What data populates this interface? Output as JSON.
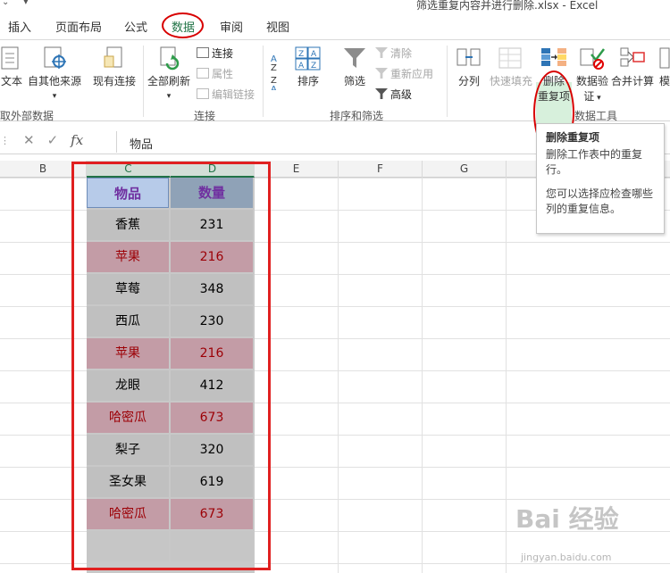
{
  "window": {
    "title": "筛选重复内容并进行删除.xlsx - Excel"
  },
  "tabs": [
    "插入",
    "页面布局",
    "公式",
    "数据",
    "审阅",
    "视图"
  ],
  "active_tab": "数据",
  "ribbon": {
    "get_external": {
      "from_text": "文本",
      "from_other": "自其他来源",
      "existing": "现有连接",
      "label": "取外部数据"
    },
    "connections": {
      "refresh_all": "全部刷新",
      "connections": "连接",
      "properties": "属性",
      "edit_links": "编辑链接",
      "label": "连接"
    },
    "sort_filter": {
      "sort": "排序",
      "filter": "筛选",
      "clear": "清除",
      "reapply": "重新应用",
      "advanced": "高级",
      "label": "排序和筛选"
    },
    "data_tools": {
      "text_to_columns": "分列",
      "flash_fill": "快速填充",
      "remove_duplicates_line1": "删除",
      "remove_duplicates_line2": "重复项",
      "validation_line1": "数据验",
      "validation_line2": "证",
      "consolidate": "合并计算",
      "model": "模",
      "label": "数据工具"
    }
  },
  "tooltip": {
    "title": "删除重复项",
    "desc": "删除工作表中的重复行。",
    "detail": "您可以选择应检查哪些列的重复信息。"
  },
  "formula_bar": {
    "fx": "fx",
    "content": "物品"
  },
  "columns": [
    "B",
    "C",
    "D",
    "E",
    "F",
    "G"
  ],
  "table": {
    "headers": [
      "物品",
      "数量"
    ],
    "rows": [
      {
        "item": "香蕉",
        "qty": "231",
        "dup": false
      },
      {
        "item": "苹果",
        "qty": "216",
        "dup": true
      },
      {
        "item": "草莓",
        "qty": "348",
        "dup": false
      },
      {
        "item": "西瓜",
        "qty": "230",
        "dup": false
      },
      {
        "item": "苹果",
        "qty": "216",
        "dup": true
      },
      {
        "item": "龙眼",
        "qty": "412",
        "dup": false
      },
      {
        "item": "哈密瓜",
        "qty": "673",
        "dup": true
      },
      {
        "item": "梨子",
        "qty": "320",
        "dup": false
      },
      {
        "item": "圣女果",
        "qty": "619",
        "dup": false
      },
      {
        "item": "哈密瓜",
        "qty": "673",
        "dup": true
      }
    ]
  },
  "colors": {
    "duplicate_fill": "#c39ca6",
    "duplicate_text": "#9c0006",
    "normal_fill": "#c0c0c0",
    "header_text": "#7030a0",
    "annotation_red": "#e02020",
    "excel_green": "#217346"
  },
  "watermark": {
    "text": "Bai 经验",
    "sub": "jingyan.baidu.com"
  }
}
